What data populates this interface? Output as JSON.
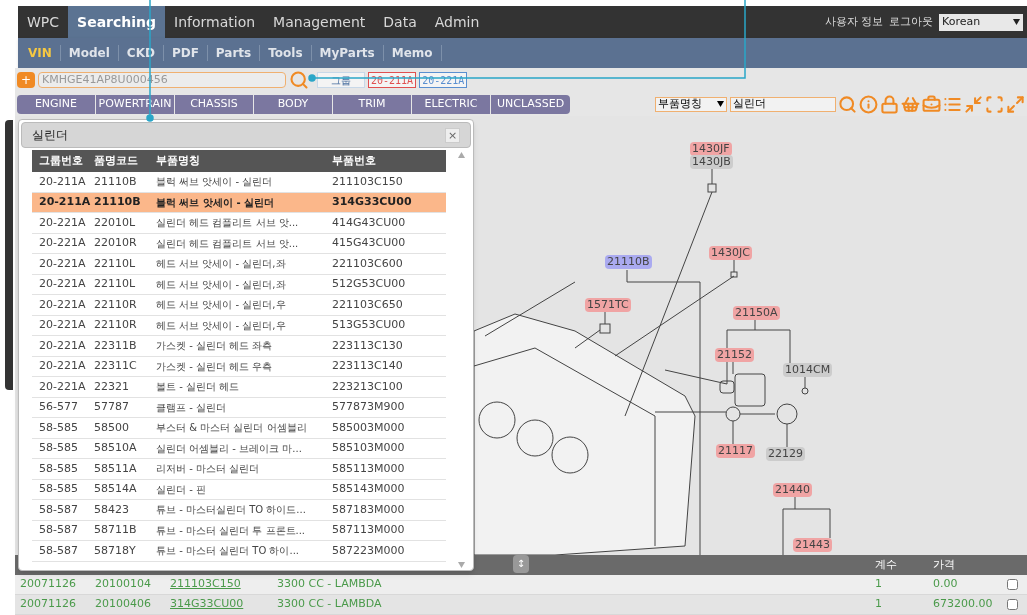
{
  "nav": {
    "items": [
      {
        "label": "WPC",
        "selected": false
      },
      {
        "label": "Searching",
        "selected": true
      },
      {
        "label": "Information",
        "selected": false
      },
      {
        "label": "Management",
        "selected": false
      },
      {
        "label": "Data",
        "selected": false
      },
      {
        "label": "Admin",
        "selected": false
      }
    ],
    "user_links": [
      "사용자 정보",
      "로그아웃"
    ],
    "language": "Korean"
  },
  "subnav": [
    {
      "label": "VIN",
      "selected": true
    },
    {
      "label": "Model",
      "selected": false
    },
    {
      "label": "CKD",
      "selected": false
    },
    {
      "label": "PDF",
      "selected": false
    },
    {
      "label": "Parts",
      "selected": false
    },
    {
      "label": "Tools",
      "selected": false
    },
    {
      "label": "MyParts",
      "selected": false
    },
    {
      "label": "Memo",
      "selected": false
    }
  ],
  "vin_search": {
    "add": "+",
    "value": "KMHGE41AP8U000456",
    "group_button": "그룹",
    "groups": [
      {
        "label": "20-211A",
        "color": "#e05050"
      },
      {
        "label": "20-221A",
        "color": "#5a8fd0"
      }
    ]
  },
  "categories": [
    "ENGINE",
    "POWERTRAIN",
    "CHASSIS",
    "BODY",
    "TRIM",
    "ELECTRIC",
    "UNCLASSED"
  ],
  "part_search": {
    "field": "부품명칭",
    "value": "실린더"
  },
  "diagram": {
    "labels": [
      {
        "text": "1430JF",
        "color": "#f0a4a4"
      },
      {
        "text": "1430JB",
        "color": "#cccccc"
      },
      {
        "text": "21110B",
        "color": "#aaaaf0"
      },
      {
        "text": "1430JC",
        "color": "#f0a4a4"
      },
      {
        "text": "1571TC",
        "color": "#f0a4a4"
      },
      {
        "text": "21150A",
        "color": "#f0a4a4"
      },
      {
        "text": "21152",
        "color": "#f0a4a4"
      },
      {
        "text": "1014CM",
        "color": "#cccccc"
      },
      {
        "text": "21117",
        "color": "#f0a4a4"
      },
      {
        "text": "22129",
        "color": "#cccccc"
      },
      {
        "text": "21440",
        "color": "#f0a4a4"
      },
      {
        "text": "21443",
        "color": "#f0a4a4"
      }
    ]
  },
  "popup": {
    "title": "실린더",
    "close": "×",
    "columns": [
      "그룹번호",
      "품명코드",
      "부품명칭",
      "부품번호"
    ],
    "rows": [
      {
        "cells": [
          "20-211A",
          "21110B",
          "블럭 써브 앗세이 - 실린더",
          "211103C150"
        ],
        "selected": false
      },
      {
        "cells": [
          "20-211A",
          "21110B",
          "블럭 써브 앗세이 - 실린더",
          "314G33CU00"
        ],
        "selected": true
      },
      {
        "cells": [
          "20-221A",
          "22010L",
          "실린더 헤드 컴플리트 서브 앗...",
          "414G43CU00"
        ],
        "selected": false
      },
      {
        "cells": [
          "20-221A",
          "22010R",
          "실린더 헤드 컴플리트 서브 앗...",
          "415G43CU00"
        ],
        "selected": false
      },
      {
        "cells": [
          "20-221A",
          "22110L",
          "헤드 서브 앗세이 - 실린더,좌",
          "221103C600"
        ],
        "selected": false
      },
      {
        "cells": [
          "20-221A",
          "22110L",
          "헤드 서브 앗세이 - 실린더,좌",
          "512G53CU00"
        ],
        "selected": false
      },
      {
        "cells": [
          "20-221A",
          "22110R",
          "헤드 서브 앗세이 - 실린더,우",
          "221103C650"
        ],
        "selected": false
      },
      {
        "cells": [
          "20-221A",
          "22110R",
          "헤드 서브 앗세이 - 실린더,우",
          "513G53CU00"
        ],
        "selected": false
      },
      {
        "cells": [
          "20-221A",
          "22311B",
          "가스켓 - 실린더 헤드 좌측",
          "223113C130"
        ],
        "selected": false
      },
      {
        "cells": [
          "20-221A",
          "22311C",
          "가스켓 - 실린더 헤드 우측",
          "223113C140"
        ],
        "selected": false
      },
      {
        "cells": [
          "20-221A",
          "22321",
          "볼트 - 실린더 헤드",
          "223213C100"
        ],
        "selected": false
      },
      {
        "cells": [
          "56-577",
          "57787",
          "클램프 - 실린더",
          "577873M900"
        ],
        "selected": false
      },
      {
        "cells": [
          "58-585",
          "58500",
          "부스터 & 마스터 실린더 어셈블리",
          "585003M000"
        ],
        "selected": false
      },
      {
        "cells": [
          "58-585",
          "58510A",
          "실린더 어셈블리 - 브레이크 마...",
          "585103M000"
        ],
        "selected": false
      },
      {
        "cells": [
          "58-585",
          "58511A",
          "리저버 - 마스터 실린더",
          "585113M000"
        ],
        "selected": false
      },
      {
        "cells": [
          "58-585",
          "58514A",
          "실린더 - 핀",
          "585143M000"
        ],
        "selected": false
      },
      {
        "cells": [
          "58-587",
          "58423",
          "튜브 - 마스터실린더 TO 하이드...",
          "587183M000"
        ],
        "selected": false
      },
      {
        "cells": [
          "58-587",
          "58711B",
          "튜브 - 마스터 실린더 투 프론트...",
          "587113M000"
        ],
        "selected": false
      },
      {
        "cells": [
          "58-587",
          "58718Y",
          "튜브 - 마스터 실린더 TO 하이...",
          "587223M000"
        ],
        "selected": false
      }
    ]
  },
  "results": {
    "resize": "↕",
    "columns": [
      "계수",
      "가격"
    ],
    "rows": [
      {
        "column_1": "20071126",
        "column_2": "20100104",
        "part_no": "211103C150",
        "description": "3300 CC - LAMBDA",
        "count": "1",
        "price": "0.00",
        "checked": false
      },
      {
        "column_1": "20071126",
        "column_2": "20100406",
        "part_no": "314G33CU00",
        "description": "3300 CC - LAMBDA",
        "count": "1",
        "price": "673200.00",
        "checked": false
      }
    ]
  }
}
